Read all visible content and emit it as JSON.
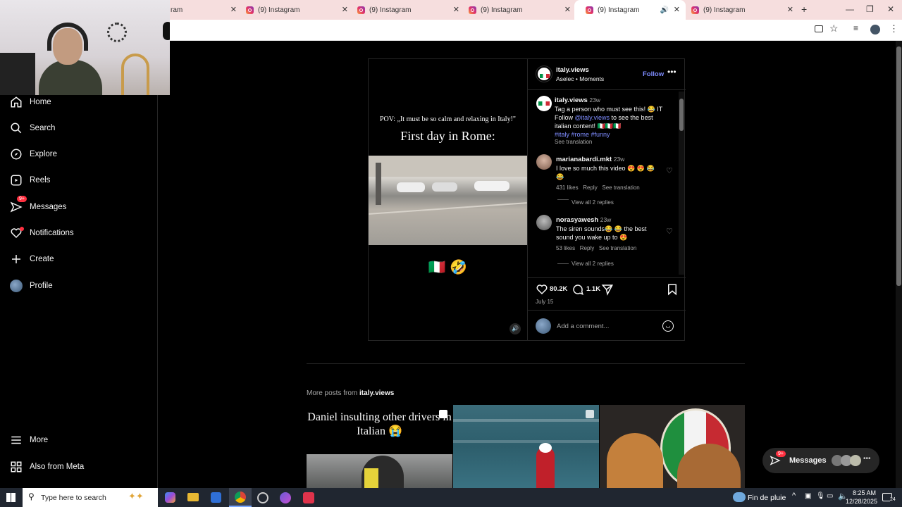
{
  "browser": {
    "tabs": [
      {
        "title": "ram"
      },
      {
        "title": "(9) Instagram"
      },
      {
        "title": "(9) Instagram"
      },
      {
        "title": "(9) Instagram"
      },
      {
        "title": "(9) Instagram"
      },
      {
        "title": "(9) Instagram"
      }
    ],
    "new_tab": "+"
  },
  "sidebar": {
    "items": [
      {
        "label": "Home",
        "icon": "home-icon"
      },
      {
        "label": "Search",
        "icon": "search-icon"
      },
      {
        "label": "Explore",
        "icon": "compass-icon"
      },
      {
        "label": "Reels",
        "icon": "reels-icon"
      },
      {
        "label": "Messages",
        "icon": "messenger-icon",
        "badge": "9+"
      },
      {
        "label": "Notifications",
        "icon": "heart-icon"
      },
      {
        "label": "Create",
        "icon": "plus-icon"
      },
      {
        "label": "Profile",
        "icon": "avatar"
      }
    ],
    "more": "More",
    "meta": "Also from Meta"
  },
  "video": {
    "caption_top": "POV: „It must be so calm and relaxing in Italy!\"",
    "title": "First day in Rome:",
    "emoji": "🇮🇹 🤣"
  },
  "post": {
    "author": "italy.views",
    "subline": "Aselec • Moments",
    "follow": "Follow",
    "caption": {
      "user": "italy.views",
      "time": "23w",
      "line1": "Tag a person who must see this! 😂 ΙΤ",
      "follow_word": "Follow",
      "mention": "@italy.views",
      "line2_rest": "to see the best",
      "line3": "italian content! 🇮🇹🇮🇹🇮🇹",
      "hashtags": "#italy #rome #funny",
      "see_translation": "See translation"
    },
    "comments": [
      {
        "user": "marianabardi.mkt",
        "time": "23w",
        "text1": "I love so much this video 😍 😍 😂",
        "text2": "😂",
        "likes": "431 likes",
        "reply": "Reply",
        "translate": "See translation",
        "replies": "View all 2 replies"
      },
      {
        "user": "norasyawesh",
        "time": "23w",
        "text1": "The siren sounds😂 😂 the best",
        "text2": "sound you wake up to 😍",
        "likes": "53 likes",
        "reply": "Reply",
        "translate": "See translation",
        "replies": "View all 2 replies"
      }
    ],
    "likes": "80.2K",
    "comments_count": "1.1K",
    "date": "July 15",
    "add_comment_placeholder": "Add a comment..."
  },
  "more_posts": {
    "prefix": "More posts from",
    "user": "italy.views",
    "thumb1_text": "Daniel insulting other drivers in Italian 😭"
  },
  "messages_pill": {
    "label": "Messages",
    "badge": "9+"
  },
  "taskbar": {
    "search_placeholder": "Type here to search",
    "weather": "Fin de pluie",
    "time": "8:25 AM",
    "date": "12/28/2025",
    "notif": "24"
  }
}
